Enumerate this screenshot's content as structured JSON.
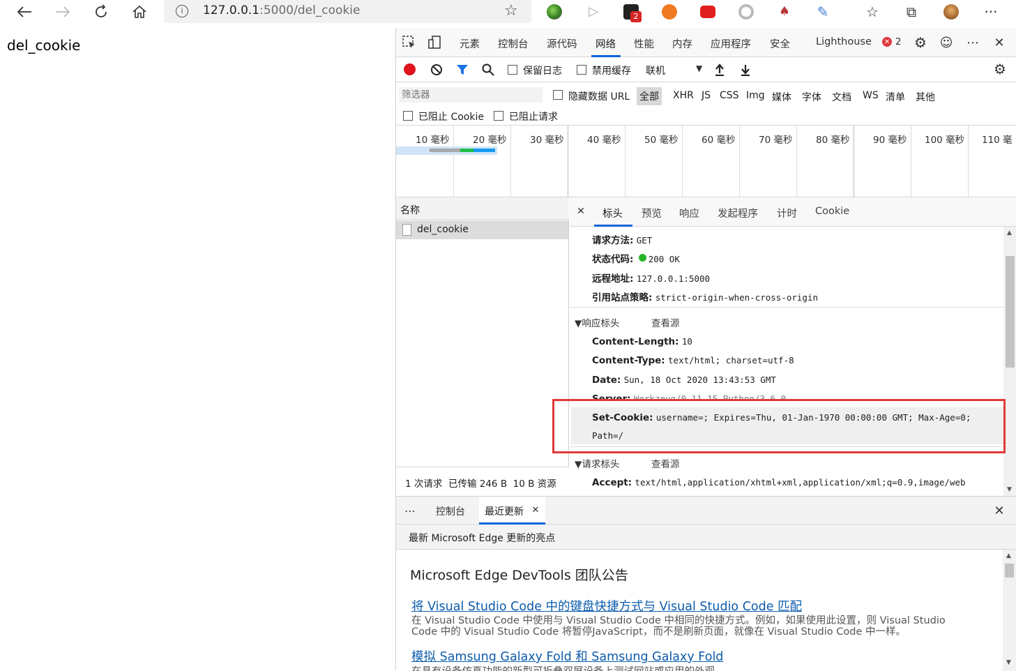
{
  "browser": {
    "url_host": "127.0.0.1",
    "url_path": ":5000/del_cookie",
    "ext_badge": "2",
    "more_label": "···"
  },
  "page": {
    "text": "del_cookie"
  },
  "devtools": {
    "tabs": [
      "元素",
      "控制台",
      "源代码",
      "网络",
      "性能",
      "内存",
      "应用程序",
      "安全",
      "Lighthouse"
    ],
    "active_tab": "网络",
    "error_count": "2",
    "network": {
      "preserve_log": "保留日志",
      "disable_cache": "禁用缓存",
      "throttle": "联机"
    },
    "filter": {
      "placeholder": "筛选器",
      "hide_data_urls": "隐藏数据 URL",
      "types": [
        "全部",
        "XHR",
        "JS",
        "CSS",
        "Img",
        "媒体",
        "字体",
        "文档",
        "WS",
        "清单",
        "其他"
      ],
      "blocked_cookies": "已阻止 Cookie",
      "blocked_requests": "已阻止请求"
    },
    "timeline_ticks": [
      "10 毫秒",
      "20 毫秒",
      "30 毫秒",
      "40 毫秒",
      "50 毫秒",
      "60 毫秒",
      "70 毫秒",
      "80 毫秒",
      "90 毫秒",
      "100 毫秒",
      "110 毫"
    ],
    "requests": {
      "header": "名称",
      "items": [
        "del_cookie"
      ],
      "summary": "1 次请求  已传输 246 B  10 B 资源"
    },
    "detail_tabs": [
      "标头",
      "预览",
      "响应",
      "发起程序",
      "计时",
      "Cookie"
    ],
    "general": [
      {
        "k": "请求方法:",
        "v": "GET"
      },
      {
        "k": "状态代码:",
        "v": "200 OK"
      },
      {
        "k": "远程地址:",
        "v": "127.0.0.1:5000"
      },
      {
        "k": "引用站点策略:",
        "v": "strict-origin-when-cross-origin"
      }
    ],
    "response_headers_title": "▼响应标头",
    "view_source": "查看源",
    "response_headers": [
      {
        "k": "Content-Length:",
        "v": "10"
      },
      {
        "k": "Content-Type:",
        "v": "text/html; charset=utf-8"
      },
      {
        "k": "Date:",
        "v": "Sun, 18 Oct 2020 13:43:53 GMT"
      },
      {
        "k": "Server:",
        "v": "Werkzeug/0.11.15 Python/3.6.0"
      },
      {
        "k": "Set-Cookie:",
        "v": "username=; Expires=Thu, 01-Jan-1970 00:00:00 GMT; Max-Age=0;"
      }
    ],
    "set_cookie_cont": "Path=/",
    "request_headers_title": "▼请求标头",
    "request_headers": [
      {
        "k": "Accept:",
        "v": "text/html,application/xhtml+xml,application/xml;q=0.9,image/web"
      }
    ],
    "drawer": {
      "tabs": [
        "控制台",
        "最近更新"
      ],
      "subtitle": "最新 Microsoft Edge 更新的亮点",
      "heading": "Microsoft Edge DevTools 团队公告",
      "link1": "将 Visual Studio Code 中的键盘快捷方式与 Visual Studio Code 匹配",
      "para1a": "在 Visual Studio Code 中使用与 Visual Studio Code 中相同的快捷方式。例如，如果使用此设置，则 Visual Studio",
      "para1b": "Code 中的 Visual Studio Code 将暂停JavaScript，而不是刷新页面，就像在 Visual Studio Code 中一样。",
      "link2": "模拟 Samsung Galaxy Fold 和 Samsung Galaxy Fold",
      "para2": "在具有设备仿真功能的新型可折叠双屏设备上测试网站或应用的外观"
    }
  },
  "colors": {
    "accent": "#0a66d8",
    "highlight": "#e03a3a",
    "status_ok": "#28b428"
  }
}
